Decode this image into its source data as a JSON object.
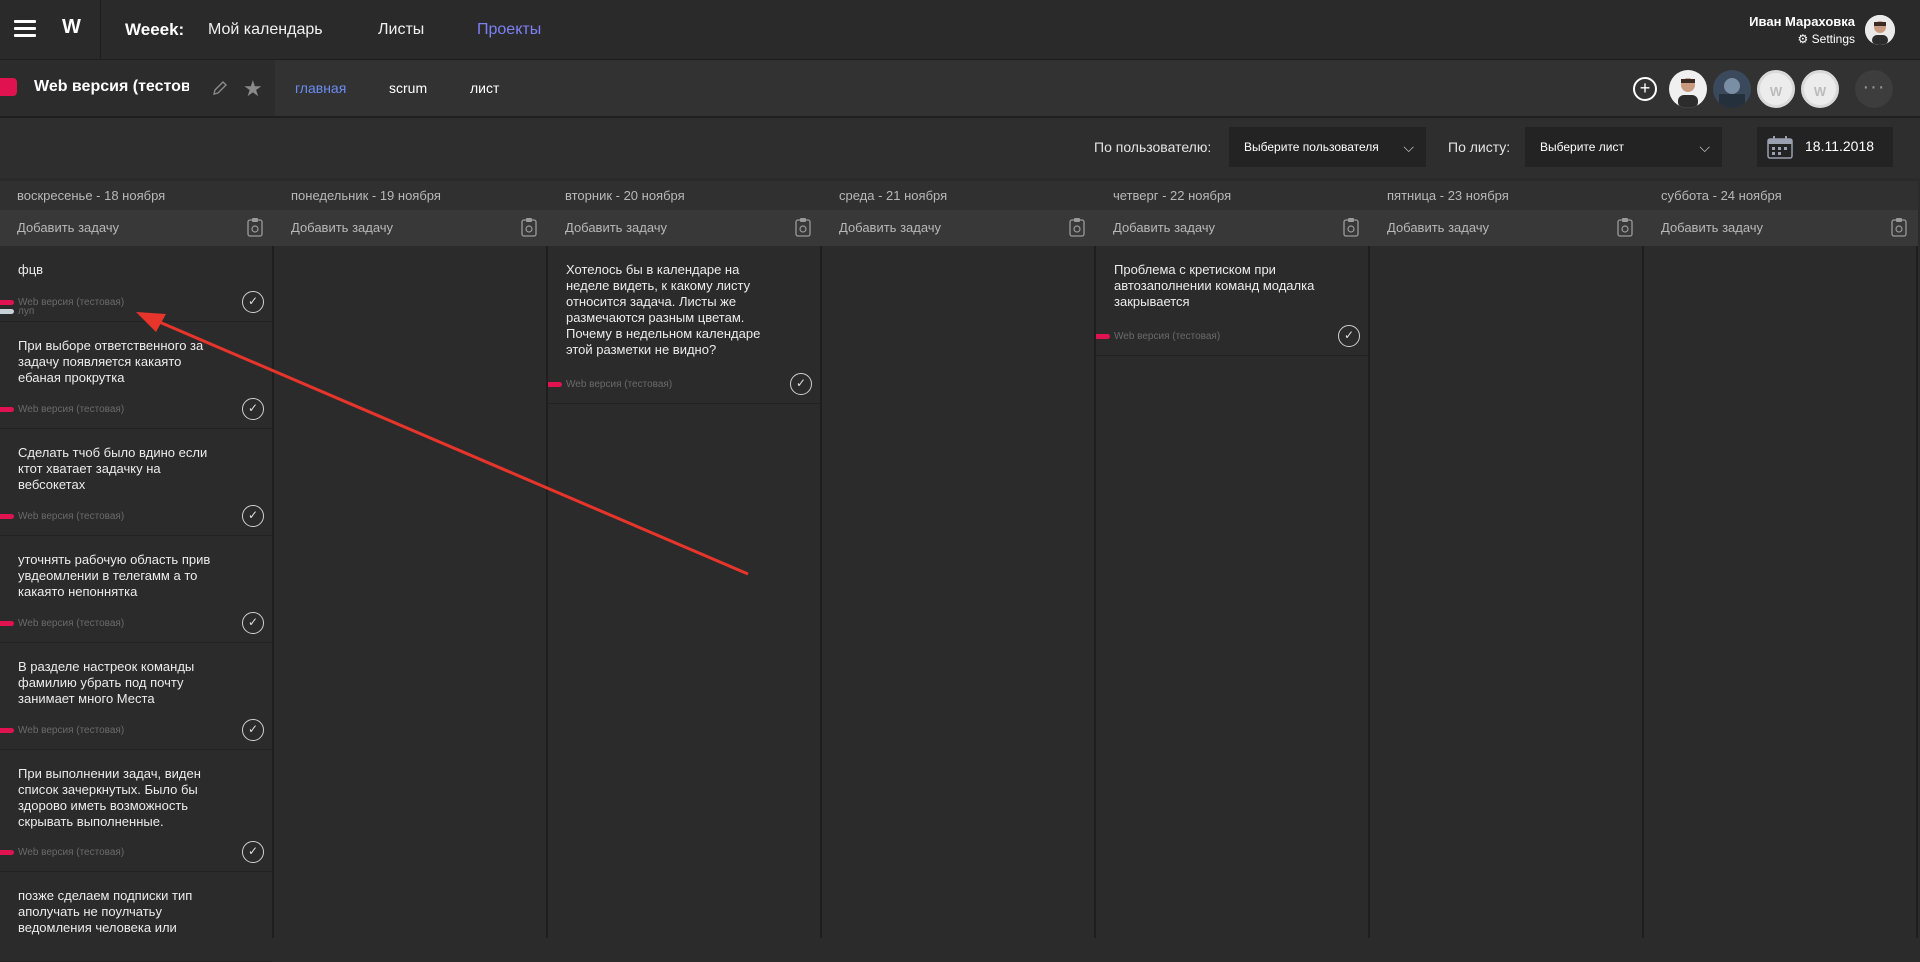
{
  "topbar": {
    "logo": "W",
    "brand": "Weeek:",
    "nav": [
      "Мой календарь",
      "Листы",
      "Проекты"
    ],
    "user_name": "Иван Мараховка",
    "settings_label": "⚙ Settings"
  },
  "project": {
    "title": "Web версия (тестовая)",
    "color": "#e0124f",
    "tabs": [
      "главная",
      "scrum",
      "лист"
    ],
    "member_initial": "W",
    "more": "···"
  },
  "filters": {
    "user_label": "По пользователю:",
    "user_select": "Выберите пользователя",
    "list_label": "По листу:",
    "list_select": "Выберите лист",
    "date": "18.11.2018"
  },
  "calendar": {
    "add_task": "Добавить задачу",
    "days": [
      {
        "label": "воскресенье - 18 ноября",
        "tasks": [
          {
            "text": "фцв",
            "project": "Web версия (тестовая)",
            "extra": "луп"
          },
          {
            "text": "При выборе ответственного за задачу появляется какаято ебаная прокрутка",
            "project": "Web версия (тестовая)"
          },
          {
            "text": "Сделать тчоб было вдино если ктот хватает задачку на вебсокетах",
            "project": "Web версия (тестовая)"
          },
          {
            "text": "уточнять рабочую область прив увдеомлении в телегамм а то какаято непоннятка",
            "project": "Web версия (тестовая)"
          },
          {
            "text": "В разделе настреок команды фамилию убрать под почту занимает много Места",
            "project": "Web версия (тестовая)"
          },
          {
            "text": "При выполнении задач, виден список зачеркнутых. Было бы здорово иметь возможность скрывать выполненные.",
            "project": "Web версия (тестовая)"
          },
          {
            "text": "позже сделаем подписки тип аполучать не поулчатьу ведомления человека или",
            "project": ""
          }
        ]
      },
      {
        "label": "понедельник - 19 ноября",
        "tasks": []
      },
      {
        "label": "вторник - 20 ноября",
        "tasks": [
          {
            "text": "Хотелось бы в календаре на неделе видеть, к какому листу относится задача. Листы же размечаются разным цветам. Почему в недельном календаре этой разметки не видно?",
            "project": "Web версия (тестовая)"
          }
        ]
      },
      {
        "label": "среда - 21 ноября",
        "tasks": []
      },
      {
        "label": "четверг - 22 ноября",
        "tasks": [
          {
            "text": "Проблема с кретиском при автозаполнении команд модалка закрывается",
            "project": "Web версия (тестовая)"
          }
        ]
      },
      {
        "label": "пятница - 23 ноября",
        "tasks": []
      },
      {
        "label": "суббота - 24 ноября",
        "tasks": []
      }
    ]
  },
  "colors": {
    "accent_nav": "#7d80f5",
    "accent_tab": "#6b8cf2",
    "tag": "#e0124f",
    "annotation_arrow": "#e8352b"
  }
}
